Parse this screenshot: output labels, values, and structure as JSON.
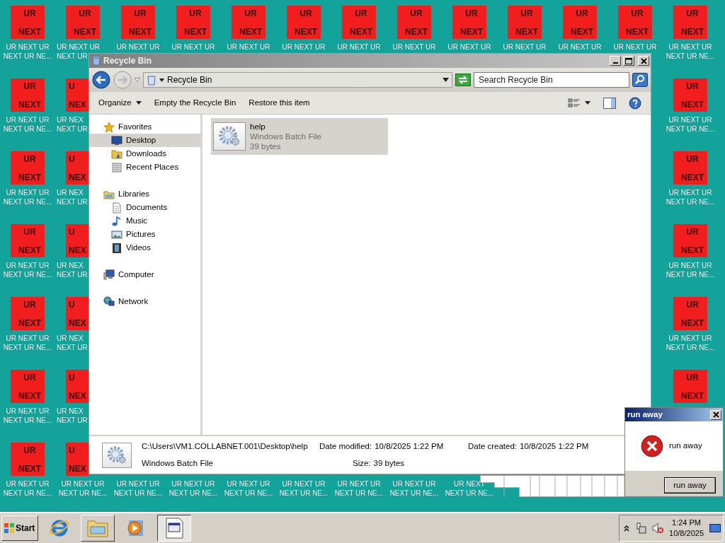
{
  "desktop": {
    "rows": [
      [
        {
          "tile_top": "UR",
          "tile_bottom": "NEXT",
          "label": [
            "UR NEXT UR",
            "NEXT UR NE..."
          ]
        },
        {
          "tile_top": "UR",
          "tile_bottom": "NEXT",
          "label": [
            "UR NEXT UR",
            "NEXT UR"
          ]
        },
        {
          "tile_top": "UR",
          "tile_bottom": "NEXT",
          "label": [
            "UR NEXT UR"
          ]
        },
        {
          "tile_top": "UR",
          "tile_bottom": "NEXT",
          "label": [
            "UR NEXT UR"
          ]
        },
        {
          "tile_top": "UR",
          "tile_bottom": "NEXT",
          "label": [
            "UR NEXT UR"
          ]
        },
        {
          "tile_top": "UR",
          "tile_bottom": "NEXT",
          "label": [
            "UR NEXT UR"
          ]
        },
        {
          "tile_top": "UR",
          "tile_bottom": "NEXT",
          "label": [
            "UR NEXT UR"
          ]
        },
        {
          "tile_top": "UR",
          "tile_bottom": "NEXT",
          "label": [
            "UR NEXT UR"
          ]
        },
        {
          "tile_top": "UR",
          "tile_bottom": "NEXT",
          "label": [
            "UR NEXT UR"
          ]
        },
        {
          "tile_top": "UR",
          "tile_bottom": "NEXT",
          "label": [
            "UR NEXT UR"
          ]
        },
        {
          "tile_top": "UR",
          "tile_bottom": "NEXT",
          "label": [
            "UR NEXT UR"
          ]
        },
        {
          "tile_top": "UR",
          "tile_bottom": "NEXT",
          "label": [
            "UR NEXT UR"
          ]
        },
        {
          "tile_top": "UR",
          "tile_bottom": "NEXT",
          "label": [
            "UR NEXT UR",
            "NEXT UR NE..."
          ]
        }
      ],
      [
        {
          "tile_top": "UR",
          "tile_bottom": "NEXT",
          "label": [
            "UR NEXT UR",
            "NEXT UR NE..."
          ]
        },
        {
          "tile_top": "U",
          "tile_bottom": "NEX",
          "label": [
            "UR NEX",
            "NEXT UR"
          ]
        },
        {},
        {},
        {},
        {},
        {},
        {},
        {},
        {},
        {},
        {},
        {
          "tile_top": "UR",
          "tile_bottom": "NEXT",
          "label": [
            "UR NEXT UR",
            "NEXT UR NE..."
          ]
        }
      ],
      [
        {
          "tile_top": "UR",
          "tile_bottom": "NEXT",
          "label": [
            "UR NEXT UR",
            "NEXT UR NE..."
          ]
        },
        {
          "tile_top": "U",
          "tile_bottom": "NEX",
          "label": [
            "UR NEX",
            "NEXT UR"
          ]
        },
        {},
        {},
        {},
        {},
        {},
        {},
        {},
        {},
        {},
        {},
        {
          "tile_top": "UR",
          "tile_bottom": "NEXT",
          "label": [
            "UR NEXT UR",
            "NEXT UR NE..."
          ]
        }
      ],
      [
        {
          "tile_top": "UR",
          "tile_bottom": "NEXT",
          "label": [
            "UR NEXT UR",
            "NEXT UR NE..."
          ]
        },
        {
          "tile_top": "U",
          "tile_bottom": "NEX",
          "label": [
            "UR NEX",
            "NEXT UR"
          ]
        },
        {},
        {},
        {},
        {},
        {},
        {},
        {},
        {},
        {},
        {},
        {
          "tile_top": "UR",
          "tile_bottom": "NEXT",
          "label": [
            "UR NEXT UR",
            "NEXT UR NE..."
          ]
        }
      ],
      [
        {
          "tile_top": "UR",
          "tile_bottom": "NEXT",
          "label": [
            "UR NEXT UR",
            "NEXT UR NE..."
          ]
        },
        {
          "tile_top": "U",
          "tile_bottom": "NEX",
          "label": [
            "UR NEX",
            "NEXT UR"
          ]
        },
        {},
        {},
        {},
        {},
        {},
        {},
        {},
        {},
        {},
        {},
        {
          "tile_top": "UR",
          "tile_bottom": "NEXT",
          "label": [
            "UR NEXT UR",
            "NEXT UR NE..."
          ]
        }
      ],
      [
        {
          "tile_top": "UR",
          "tile_bottom": "NEXT",
          "label": [
            "UR NEXT UR",
            "NEXT UR NE..."
          ]
        },
        {
          "tile_top": "U",
          "tile_bottom": "NEX",
          "label": [
            "UR NEX",
            "NEXT UR"
          ]
        },
        {},
        {},
        {},
        {},
        {},
        {},
        {},
        {},
        {},
        {},
        {
          "tile_top": "UR",
          "tile_bottom": "NEXT"
        }
      ],
      [
        {
          "tile_top": "UR",
          "tile_bottom": "NEXT",
          "label": [
            "UR NEXT UR",
            "NEXT UR NE..."
          ]
        },
        {
          "tile_top": "U",
          "tile_bottom": "NEX",
          "label": [
            "UR NEXT UR",
            "NEXT UR NE..."
          ]
        },
        {
          "label": [
            "UR NEXT UR",
            "NEXT UR NE..."
          ]
        },
        {
          "label": [
            "UR NEXT UR",
            "NEXT UR NE..."
          ]
        },
        {
          "label": [
            "UR NEXT UR",
            "NEXT UR NE..."
          ]
        },
        {
          "label": [
            "UR NEXT UR",
            "NEXT UR NE..."
          ]
        },
        {
          "label": [
            "UR NEXT UR",
            "NEXT UR NE..."
          ]
        },
        {
          "label": [
            "UR NEXT UR",
            "NEXT UR NE..."
          ]
        },
        {
          "label": [
            "UR NEXT",
            "NEXT UR NE..."
          ]
        }
      ]
    ]
  },
  "window": {
    "title": "Recycle Bin",
    "address": "Recycle Bin",
    "search": {
      "placeholder": "Search Recycle Bin"
    },
    "commands": [
      {
        "label": "Organize",
        "dropdown": true
      },
      {
        "label": "Empty the Recycle Bin",
        "dropdown": false
      },
      {
        "label": "Restore this item",
        "dropdown": false
      }
    ],
    "nav": [
      {
        "label": "Favorites",
        "kind": "star",
        "children": [
          {
            "label": "Desktop",
            "kind": "desktop",
            "selected": true
          },
          {
            "label": "Downloads",
            "kind": "downloads",
            "selected": false
          },
          {
            "label": "Recent Places",
            "kind": "recent",
            "selected": false
          }
        ]
      },
      {
        "label": "Libraries",
        "kind": "libraries",
        "children": [
          {
            "label": "Documents",
            "kind": "documents",
            "selected": false
          },
          {
            "label": "Music",
            "kind": "music",
            "selected": false
          },
          {
            "label": "Pictures",
            "kind": "pictures",
            "selected": false
          },
          {
            "label": "Videos",
            "kind": "videos",
            "selected": false
          }
        ]
      },
      {
        "label": "Computer",
        "kind": "computer"
      },
      {
        "label": "Network",
        "kind": "network"
      }
    ],
    "files": [
      {
        "name": "help",
        "type": "Windows Batch File",
        "size": "39 bytes",
        "selected": true
      }
    ],
    "details": {
      "path": "C:\\Users\\VM1.COLLABNET.001\\Desktop\\help",
      "type": "Windows Batch File",
      "fields": [
        {
          "label": "Date modified:",
          "value": "10/8/2025 1:22 PM"
        },
        {
          "label": "Size:",
          "value": "39 bytes"
        },
        {
          "label": "Date created:",
          "value": "10/8/2025 1:22 PM"
        }
      ]
    }
  },
  "dialog": {
    "title": "run away",
    "message": "run away",
    "button": "run away"
  },
  "taskbar": {
    "start": "Start",
    "apps": [
      {
        "kind": "ie",
        "open": false,
        "active": false
      },
      {
        "kind": "explorer",
        "open": true,
        "active": false
      },
      {
        "kind": "media",
        "open": false,
        "active": false
      },
      {
        "kind": "batch",
        "open": true,
        "active": true
      }
    ],
    "clock": {
      "time": "1:24 PM",
      "date": "10/8/2025"
    }
  }
}
